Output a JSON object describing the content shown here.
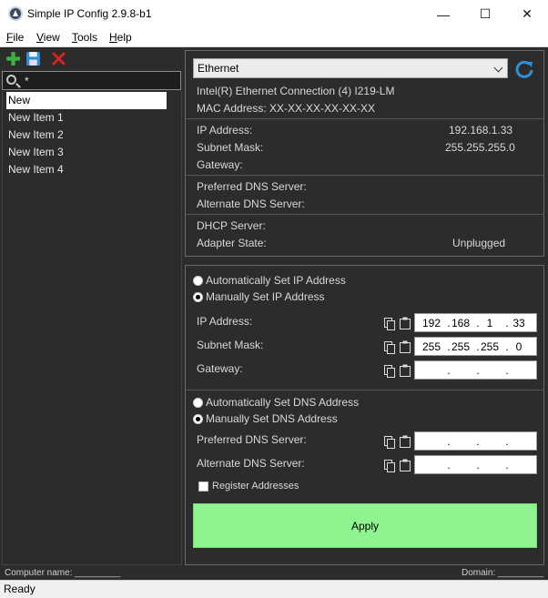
{
  "window": {
    "title": "Simple IP Config 2.9.8-b1",
    "minimize_glyph": "—",
    "maximize_glyph": "☐",
    "close_glyph": "✕"
  },
  "menu": {
    "items": [
      {
        "first": "F",
        "rest": "ile"
      },
      {
        "first": "V",
        "rest": "iew"
      },
      {
        "first": "T",
        "rest": "ools"
      },
      {
        "first": "H",
        "rest": "elp"
      }
    ]
  },
  "toolbar": {
    "icons": [
      "add-icon",
      "save-icon",
      "delete-icon"
    ],
    "colors": {
      "add": "#3cb043",
      "save": "#2f8fd8",
      "delete": "#e02020"
    }
  },
  "search": {
    "value": "*"
  },
  "profiles": {
    "items": [
      {
        "label": "New",
        "selected": true
      },
      {
        "label": "New Item 1"
      },
      {
        "label": "New Item 2"
      },
      {
        "label": "New Item 3"
      },
      {
        "label": "New Item 4"
      }
    ]
  },
  "adapter": {
    "selected": "Ethernet",
    "description": "Intel(R) Ethernet Connection (4) I219-LM",
    "mac": "MAC Address: XX-XX-XX-XX-XX-XX"
  },
  "current": {
    "ip_label": "IP Address:",
    "ip_value": "192.168.1.33",
    "subnet_label": "Subnet Mask:",
    "subnet_value": "255.255.255.0",
    "gateway_label": "Gateway:",
    "gateway_value": "",
    "pref_dns_label": "Preferred DNS Server:",
    "alt_dns_label": "Alternate DNS Server:",
    "dhcp_label": "DHCP Server:",
    "state_label": "Adapter State:",
    "state_value": "Unplugged"
  },
  "config": {
    "auto_ip": "Automatically Set IP Address",
    "manual_ip": "Manually Set IP Address",
    "ip_label": "IP Address:",
    "subnet_label": "Subnet Mask:",
    "gateway_label": "Gateway:",
    "ip_octets": [
      "192",
      "168",
      "1",
      "33"
    ],
    "subnet_octets": [
      "255",
      "255",
      "255",
      "0"
    ],
    "auto_dns": "Automatically Set DNS Address",
    "manual_dns": "Manually Set DNS Address",
    "pref_dns_label": "Preferred DNS Server:",
    "alt_dns_label": "Alternate DNS Server:",
    "register": "Register Addresses",
    "apply": "Apply",
    "apply_color": "#8ff48f"
  },
  "footer": {
    "computer_name": "Computer name: _________",
    "domain": "Domain: _________",
    "status": "Ready"
  }
}
